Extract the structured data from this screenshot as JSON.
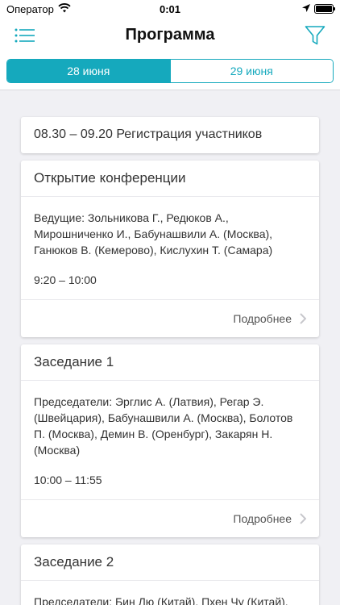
{
  "status_bar": {
    "carrier": "Оператор",
    "time": "0:01"
  },
  "navbar": {
    "title": "Программа"
  },
  "tabs": [
    {
      "label": "28 июня",
      "active": true
    },
    {
      "label": "29 июня",
      "active": false
    }
  ],
  "accent_color": "#15a9bd",
  "program": {
    "registration": "08.30 – 09.20 Регистрация участников",
    "sessions": [
      {
        "title": "Открытие конференции",
        "chairs": "Ведущие: Зольникова Г., Редюков А., Мирошниченко И., Бабунашвили А. (Москва), Ганюков В. (Кемерово), Кислухин Т. (Самара)",
        "time": "9:20 – 10:00",
        "more": "Подробнее"
      },
      {
        "title": "Заседание 1",
        "chairs": "Председатели: Эрглис А. (Латвия), Регар Э. (Швейцария), Бабунашвили А. (Москва), Болотов П. (Москва), Демин В. (Оренбург), Закарян Н. (Москва)",
        "time": "10:00 – 11:55",
        "more": "Подробнее"
      },
      {
        "title": "Заседание 2",
        "chairs": "Председатели: Бин Лю (Китай), Пхен Чу (Китай),"
      }
    ]
  }
}
